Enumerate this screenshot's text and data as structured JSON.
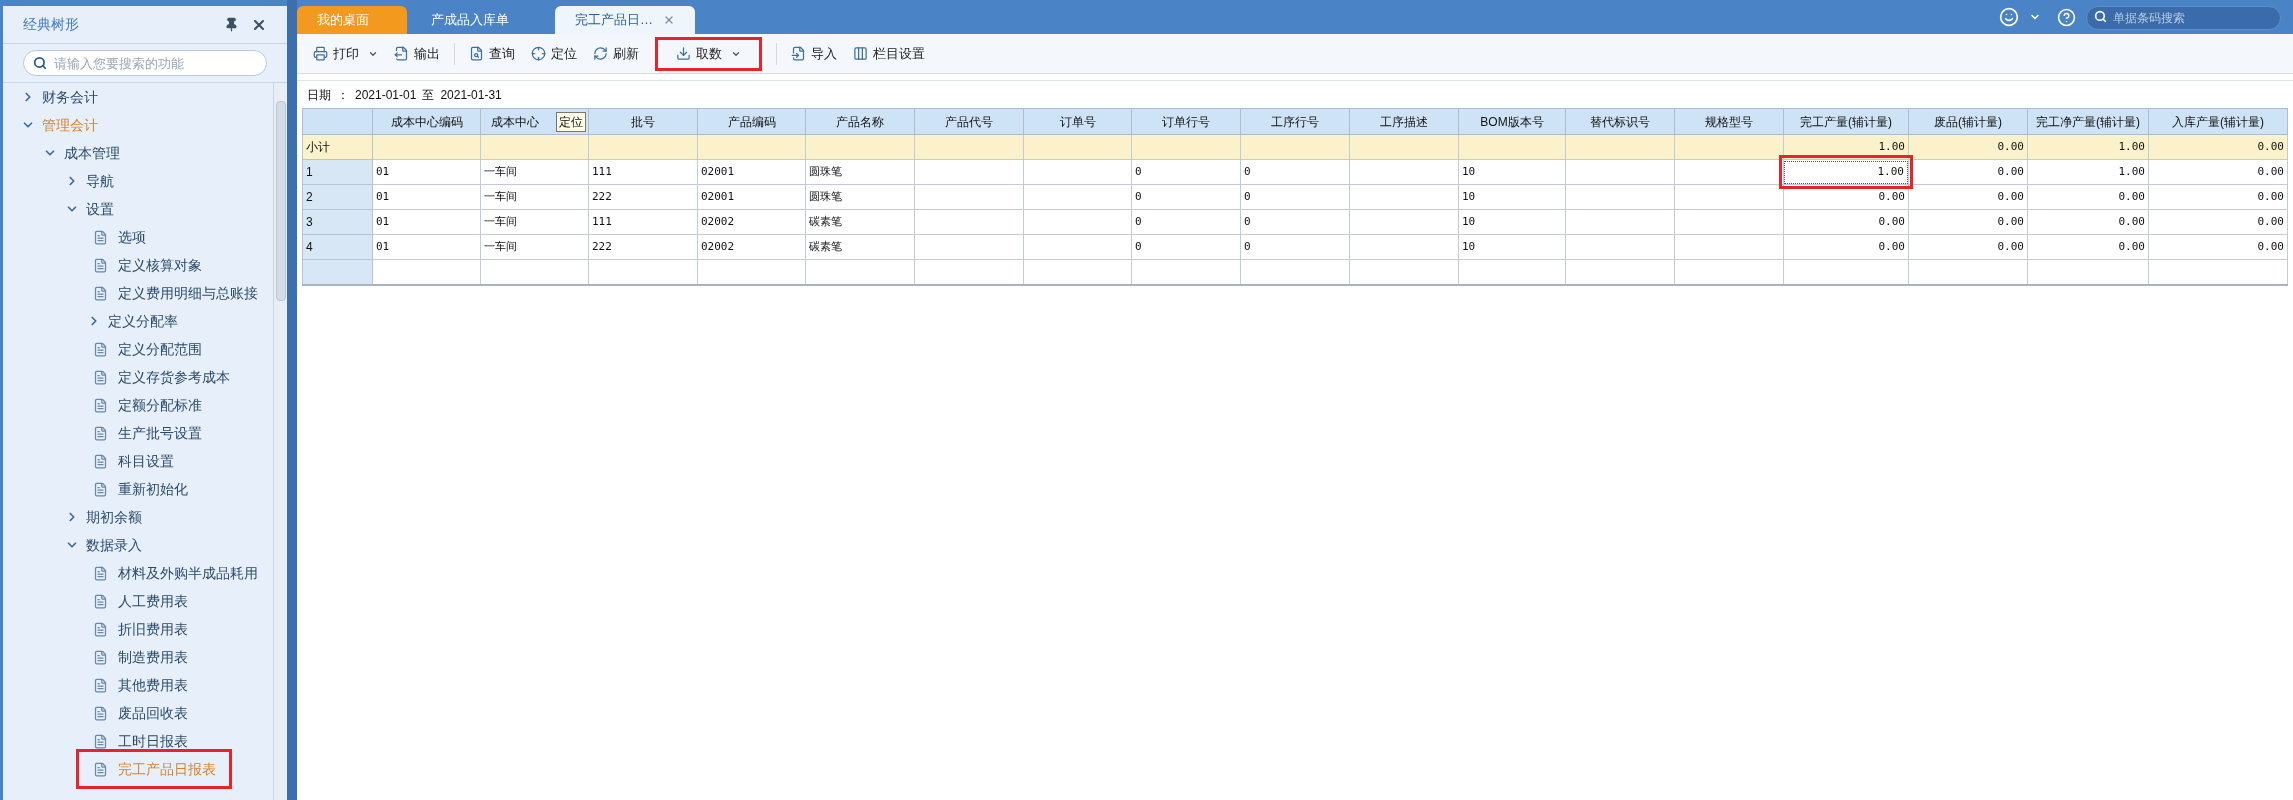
{
  "sidebar": {
    "title": "经典树形",
    "search": {
      "placeholder": "请输入您要搜索的功能"
    },
    "tree": [
      {
        "label": "财务会计",
        "kind": "folder",
        "expanded": false,
        "selected": false
      },
      {
        "label": "管理会计",
        "kind": "folder",
        "expanded": true,
        "selected": true,
        "children": [
          {
            "label": "成本管理",
            "kind": "folder",
            "expanded": true,
            "selected": false,
            "children": [
              {
                "label": "导航",
                "kind": "folder",
                "expanded": false,
                "selected": false
              },
              {
                "label": "设置",
                "kind": "folder",
                "expanded": true,
                "selected": false,
                "children": [
                  {
                    "label": "选项",
                    "kind": "leaf",
                    "selected": false,
                    "highlighted": false
                  },
                  {
                    "label": "定义核算对象",
                    "kind": "leaf",
                    "selected": false,
                    "highlighted": false
                  },
                  {
                    "label": "定义费用明细与总账接",
                    "kind": "leaf",
                    "selected": false,
                    "highlighted": false
                  },
                  {
                    "label": "定义分配率",
                    "kind": "folder",
                    "expanded": false,
                    "selected": false
                  },
                  {
                    "label": "定义分配范围",
                    "kind": "leaf",
                    "selected": false,
                    "highlighted": false
                  },
                  {
                    "label": "定义存货参考成本",
                    "kind": "leaf",
                    "selected": false,
                    "highlighted": false
                  },
                  {
                    "label": "定额分配标准",
                    "kind": "leaf",
                    "selected": false,
                    "highlighted": false
                  },
                  {
                    "label": "生产批号设置",
                    "kind": "leaf",
                    "selected": false,
                    "highlighted": false
                  },
                  {
                    "label": "科目设置",
                    "kind": "leaf",
                    "selected": false,
                    "highlighted": false
                  },
                  {
                    "label": "重新初始化",
                    "kind": "leaf",
                    "selected": false,
                    "highlighted": false
                  }
                ]
              },
              {
                "label": "期初余额",
                "kind": "folder",
                "expanded": false,
                "selected": false
              },
              {
                "label": "数据录入",
                "kind": "folder",
                "expanded": true,
                "selected": false,
                "children": [
                  {
                    "label": "材料及外购半成品耗用",
                    "kind": "leaf",
                    "selected": false,
                    "highlighted": false
                  },
                  {
                    "label": "人工费用表",
                    "kind": "leaf",
                    "selected": false,
                    "highlighted": false
                  },
                  {
                    "label": "折旧费用表",
                    "kind": "leaf",
                    "selected": false,
                    "highlighted": false
                  },
                  {
                    "label": "制造费用表",
                    "kind": "leaf",
                    "selected": false,
                    "highlighted": false
                  },
                  {
                    "label": "其他费用表",
                    "kind": "leaf",
                    "selected": false,
                    "highlighted": false
                  },
                  {
                    "label": "废品回收表",
                    "kind": "leaf",
                    "selected": false,
                    "highlighted": false
                  },
                  {
                    "label": "工时日报表",
                    "kind": "leaf",
                    "selected": false,
                    "highlighted": false
                  },
                  {
                    "label": "完工产品日报表",
                    "kind": "leaf",
                    "selected": true,
                    "highlighted": true
                  }
                ]
              }
            ]
          }
        ]
      }
    ]
  },
  "tabs": [
    {
      "label": "我的桌面",
      "kind": "home",
      "selected": false,
      "closable": false
    },
    {
      "label": "产成品入库单",
      "kind": "page",
      "selected": false,
      "closable": false
    },
    {
      "label": "完工产品日…",
      "kind": "page",
      "selected": true,
      "closable": true
    }
  ],
  "top_search": {
    "placeholder": "单据条码搜索"
  },
  "toolbar": [
    {
      "label": "打印",
      "dropdown": true,
      "highlighted": false
    },
    {
      "label": "输出",
      "dropdown": false,
      "highlighted": false
    },
    {
      "label": "查询",
      "dropdown": false,
      "highlighted": false
    },
    {
      "label": "定位",
      "dropdown": false,
      "highlighted": false
    },
    {
      "label": "刷新",
      "dropdown": false,
      "highlighted": false
    },
    {
      "label": "取数",
      "dropdown": true,
      "highlighted": true
    },
    {
      "label": "导入",
      "dropdown": false,
      "highlighted": false
    },
    {
      "label": "栏目设置",
      "dropdown": false,
      "highlighted": false
    }
  ],
  "date_filter": {
    "label": "日期",
    "separator": "：",
    "from": "2021-01-01",
    "to_label": "至",
    "to": "2021-01-31"
  },
  "tooltip": "定位",
  "table": {
    "columns": [
      {
        "label": "成本中心编码",
        "kind": "text"
      },
      {
        "label": "成本中心",
        "kind": "text"
      },
      {
        "label": "批号",
        "kind": "text"
      },
      {
        "label": "产品编码",
        "kind": "text"
      },
      {
        "label": "产品名称",
        "kind": "text"
      },
      {
        "label": "产品代号",
        "kind": "text"
      },
      {
        "label": "订单号",
        "kind": "text"
      },
      {
        "label": "订单行号",
        "kind": "text"
      },
      {
        "label": "工序行号",
        "kind": "text"
      },
      {
        "label": "工序描述",
        "kind": "text"
      },
      {
        "label": "BOM版本号",
        "kind": "text"
      },
      {
        "label": "替代标识号",
        "kind": "text"
      },
      {
        "label": "规格型号",
        "kind": "text"
      },
      {
        "label": "完工产量(辅计量)",
        "kind": "number"
      },
      {
        "label": "废品(辅计量)",
        "kind": "number"
      },
      {
        "label": "完工净产量(辅计量)",
        "kind": "number"
      },
      {
        "label": "入库产量(辅计量)",
        "kind": "number"
      }
    ],
    "rows": [
      {
        "label": "小计",
        "kind": "subtotal",
        "cells": [
          {
            "highlighted": false
          },
          {
            "highlighted": false
          },
          {
            "highlighted": false
          },
          {
            "highlighted": false
          },
          {
            "highlighted": false
          },
          {
            "highlighted": false
          },
          {
            "highlighted": false
          },
          {
            "highlighted": false
          },
          {
            "highlighted": false
          },
          {
            "highlighted": false
          },
          {
            "highlighted": false
          },
          {
            "highlighted": false
          },
          {
            "highlighted": false
          },
          {
            "text": "1.00",
            "highlighted": false
          },
          {
            "text": "0.00",
            "highlighted": false
          },
          {
            "text": "1.00",
            "highlighted": false
          },
          {
            "text": "0.00",
            "highlighted": false
          }
        ]
      },
      {
        "label": "1",
        "kind": "data",
        "cells": [
          {
            "text": "01",
            "highlighted": false
          },
          {
            "text": "一车间",
            "highlighted": false
          },
          {
            "text": "111",
            "highlighted": false
          },
          {
            "text": "02001",
            "highlighted": false
          },
          {
            "text": "圆珠笔",
            "highlighted": false
          },
          {
            "highlighted": false
          },
          {
            "highlighted": false
          },
          {
            "text": "0",
            "highlighted": false
          },
          {
            "text": "0",
            "highlighted": false
          },
          {
            "highlighted": false
          },
          {
            "text": "10",
            "highlighted": false
          },
          {
            "highlighted": false
          },
          {
            "highlighted": false
          },
          {
            "text": "1.00",
            "highlighted": true
          },
          {
            "text": "0.00",
            "highlighted": false
          },
          {
            "text": "1.00",
            "highlighted": false
          },
          {
            "text": "0.00",
            "highlighted": false
          }
        ]
      },
      {
        "label": "2",
        "kind": "data",
        "cells": [
          {
            "text": "01",
            "highlighted": false
          },
          {
            "text": "一车间",
            "highlighted": false
          },
          {
            "text": "222",
            "highlighted": false
          },
          {
            "text": "02001",
            "highlighted": false
          },
          {
            "text": "圆珠笔",
            "highlighted": false
          },
          {
            "highlighted": false
          },
          {
            "highlighted": false
          },
          {
            "text": "0",
            "highlighted": false
          },
          {
            "text": "0",
            "highlighted": false
          },
          {
            "highlighted": false
          },
          {
            "text": "10",
            "highlighted": false
          },
          {
            "highlighted": false
          },
          {
            "highlighted": false
          },
          {
            "text": "0.00",
            "highlighted": false
          },
          {
            "text": "0.00",
            "highlighted": false
          },
          {
            "text": "0.00",
            "highlighted": false
          },
          {
            "text": "0.00",
            "highlighted": false
          }
        ]
      },
      {
        "label": "3",
        "kind": "data",
        "cells": [
          {
            "text": "01",
            "highlighted": false
          },
          {
            "text": "一车间",
            "highlighted": false
          },
          {
            "text": "111",
            "highlighted": false
          },
          {
            "text": "02002",
            "highlighted": false
          },
          {
            "text": "碳素笔",
            "highlighted": false
          },
          {
            "highlighted": false
          },
          {
            "highlighted": false
          },
          {
            "text": "0",
            "highlighted": false
          },
          {
            "text": "0",
            "highlighted": false
          },
          {
            "highlighted": false
          },
          {
            "text": "10",
            "highlighted": false
          },
          {
            "highlighted": false
          },
          {
            "highlighted": false
          },
          {
            "text": "0.00",
            "highlighted": false
          },
          {
            "text": "0.00",
            "highlighted": false
          },
          {
            "text": "0.00",
            "highlighted": false
          },
          {
            "text": "0.00",
            "highlighted": false
          }
        ]
      },
      {
        "label": "4",
        "kind": "data",
        "cells": [
          {
            "text": "01",
            "highlighted": false
          },
          {
            "text": "一车间",
            "highlighted": false
          },
          {
            "text": "222",
            "highlighted": false
          },
          {
            "text": "02002",
            "highlighted": false
          },
          {
            "text": "碳素笔",
            "highlighted": false
          },
          {
            "highlighted": false
          },
          {
            "highlighted": false
          },
          {
            "text": "0",
            "highlighted": false
          },
          {
            "text": "0",
            "highlighted": false
          },
          {
            "highlighted": false
          },
          {
            "text": "10",
            "highlighted": false
          },
          {
            "highlighted": false
          },
          {
            "highlighted": false
          },
          {
            "text": "0.00",
            "highlighted": false
          },
          {
            "text": "0.00",
            "highlighted": false
          },
          {
            "text": "0.00",
            "highlighted": false
          },
          {
            "text": "0.00",
            "highlighted": false
          }
        ]
      }
    ]
  }
}
